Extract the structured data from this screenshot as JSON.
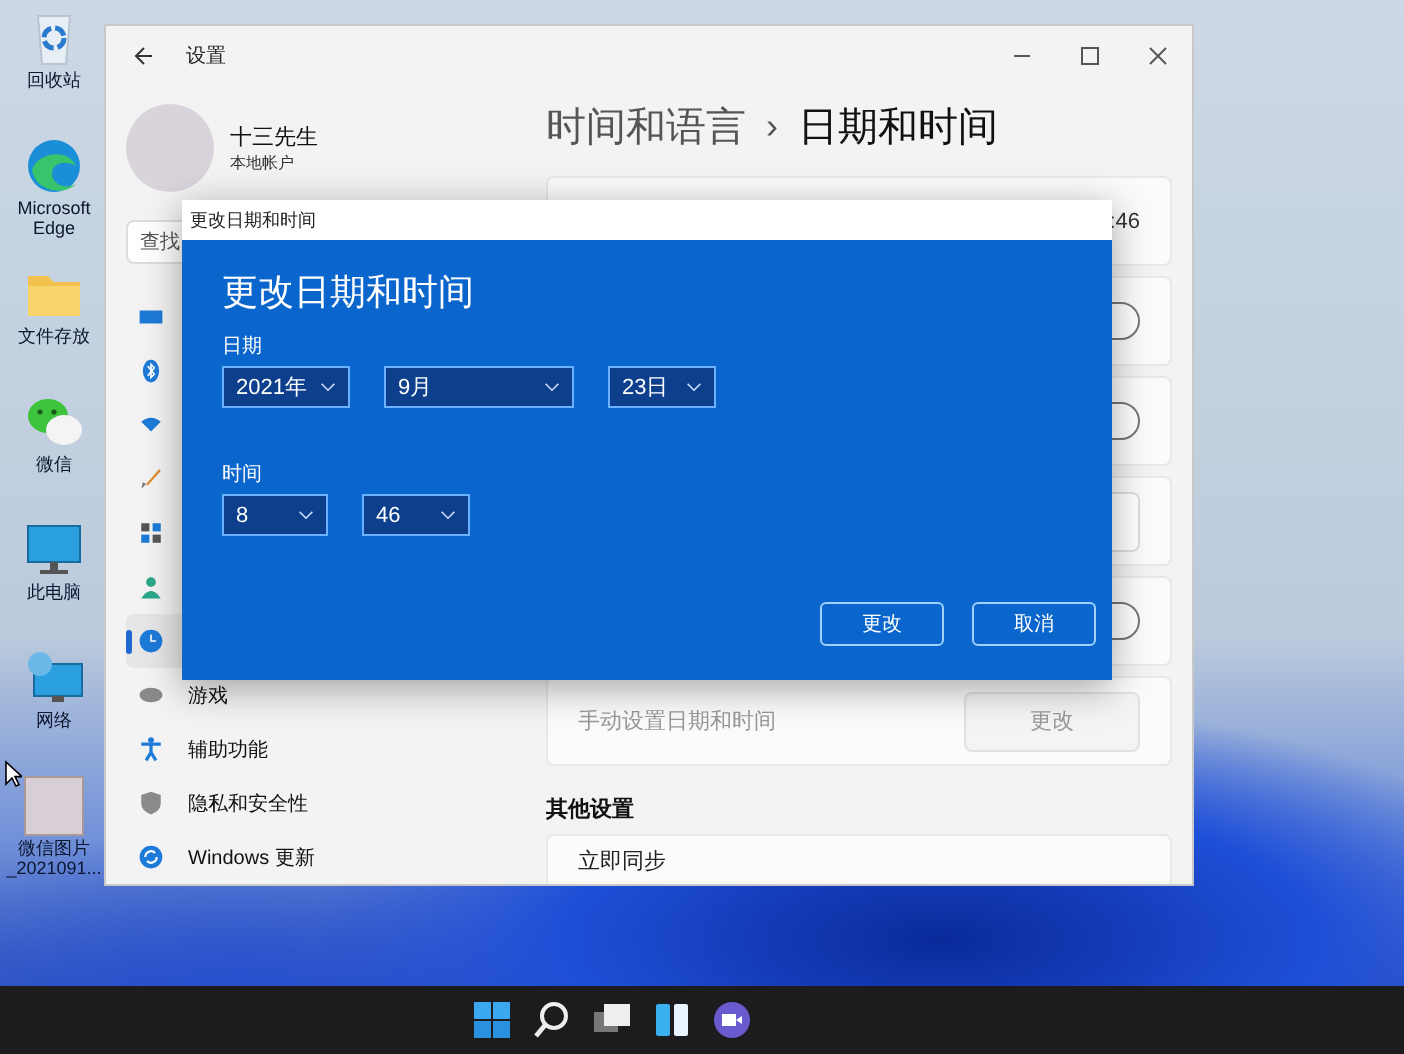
{
  "desktop_icons": [
    {
      "label": "回收站",
      "kind": "recycle"
    },
    {
      "label": "Microsoft Edge",
      "kind": "browser"
    },
    {
      "label": "文件存放",
      "kind": "folder"
    },
    {
      "label": "微信",
      "kind": "chat"
    },
    {
      "label": "此电脑",
      "kind": "computer"
    },
    {
      "label": "网络",
      "kind": "network"
    },
    {
      "label": "微信图片_2021091...",
      "kind": "photo"
    }
  ],
  "settings": {
    "title": "设置",
    "user": {
      "name": "十三先生",
      "account": "本地帐户"
    },
    "search": {
      "placeholder": "查找"
    },
    "sidebar": {
      "items": [
        {
          "kind": "system",
          "selected": false
        },
        {
          "kind": "bluetooth",
          "selected": false
        },
        {
          "kind": "network",
          "selected": false
        },
        {
          "kind": "brush",
          "selected": false
        },
        {
          "kind": "apps",
          "selected": false
        },
        {
          "kind": "account",
          "selected": false
        },
        {
          "kind": "time",
          "selected": true
        },
        {
          "kind": "gaming",
          "label": "游戏",
          "selected": false
        },
        {
          "kind": "accessibility",
          "label": "辅助功能",
          "selected": false
        },
        {
          "kind": "privacy",
          "label": "隐私和安全性",
          "selected": false
        },
        {
          "kind": "update",
          "label": "Windows 更新",
          "selected": false
        }
      ]
    },
    "breadcrumb": {
      "parent": "时间和语言",
      "separator": "›",
      "current": "日期和时间"
    },
    "rows": [
      {
        "kind": "value",
        "value": ":46"
      },
      {
        "kind": "toggle",
        "on": false
      },
      {
        "kind": "toggle",
        "on": false
      },
      {
        "kind": "dropdown"
      },
      {
        "kind": "toggle",
        "on": false
      },
      {
        "kind": "button",
        "label": "手动设置日期和时间",
        "button": "更改",
        "disabled": true
      }
    ],
    "other_section": {
      "title": "其他设置",
      "rows": [
        {
          "label": "立即同步"
        }
      ]
    }
  },
  "dialog": {
    "title": "更改日期和时间",
    "heading": "更改日期和时间",
    "date_label": "日期",
    "date_fields": [
      {
        "value": "2021年"
      },
      {
        "value": "9月"
      },
      {
        "value": "23日"
      }
    ],
    "time_label": "时间",
    "time_fields": [
      {
        "value": "8"
      },
      {
        "value": "46"
      }
    ],
    "buttons": [
      "更改",
      "取消"
    ]
  },
  "taskbar": {
    "items": [
      {
        "kind": "start"
      },
      {
        "kind": "search"
      },
      {
        "kind": "taskview"
      },
      {
        "kind": "widgets"
      },
      {
        "kind": "chat"
      }
    ]
  }
}
